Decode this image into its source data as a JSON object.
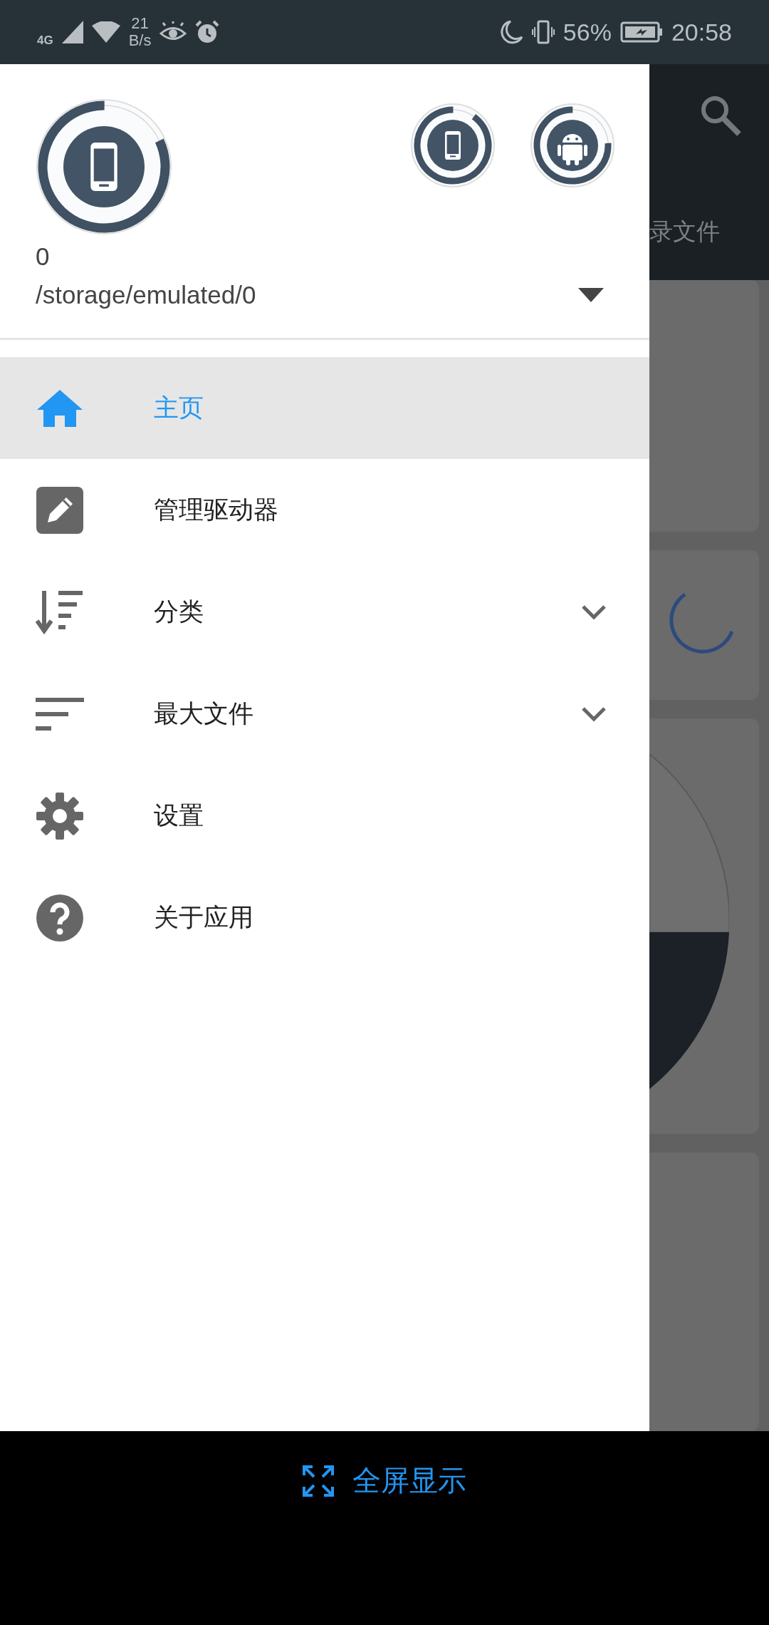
{
  "status_bar": {
    "network": "4G",
    "speed_value": "21",
    "speed_unit": "B/s",
    "battery": "56%",
    "time": "20:58"
  },
  "drawer": {
    "storages": [
      {
        "level": 0.82
      },
      {
        "level": 0.9
      },
      {
        "level": 0.76
      }
    ],
    "storage_name": "0",
    "storage_path": "/storage/emulated/0",
    "menu": [
      {
        "label": "主页",
        "selected": true,
        "expandable": false
      },
      {
        "label": "管理驱动器",
        "selected": false,
        "expandable": false
      },
      {
        "label": "分类",
        "selected": false,
        "expandable": true
      },
      {
        "label": "最大文件",
        "selected": false,
        "expandable": true
      },
      {
        "label": "设置",
        "selected": false,
        "expandable": false
      },
      {
        "label": "关于应用",
        "selected": false,
        "expandable": false
      }
    ]
  },
  "background_app": {
    "tab_label": "录文件"
  },
  "bottom_bar": {
    "fullscreen_label": "全屏显示"
  }
}
